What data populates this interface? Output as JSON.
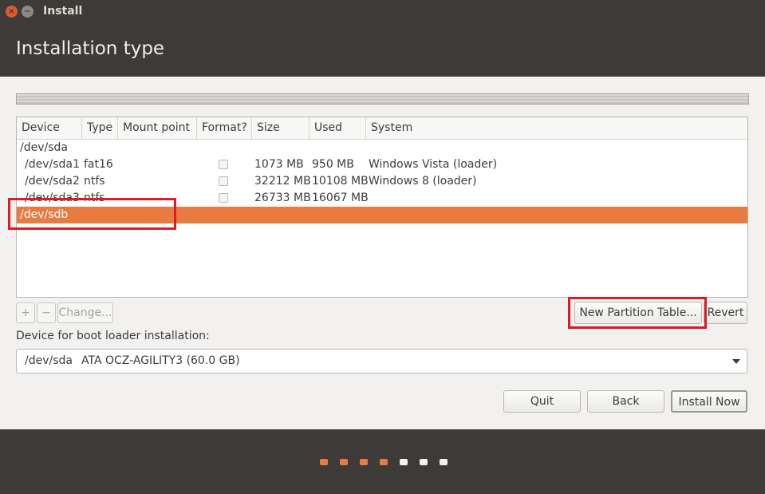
{
  "window": {
    "title": "Install"
  },
  "header": {
    "title": "Installation type"
  },
  "table": {
    "columns": [
      "Device",
      "Type",
      "Mount point",
      "Format?",
      "Size",
      "Used",
      "System"
    ],
    "rows": [
      {
        "device": "/dev/sda",
        "type": "",
        "mount": "",
        "format": false,
        "size": "",
        "used": "",
        "system": ""
      },
      {
        "device": "/dev/sda1",
        "type": "fat16",
        "mount": "",
        "format": false,
        "size": "1073 MB",
        "used": "950 MB",
        "system": "Windows Vista (loader)"
      },
      {
        "device": "/dev/sda2",
        "type": "ntfs",
        "mount": "",
        "format": false,
        "size": "32212 MB",
        "used": "10108 MB",
        "system": "Windows 8 (loader)"
      },
      {
        "device": "/dev/sda3",
        "type": "ntfs",
        "mount": "",
        "format": false,
        "size": "26733 MB",
        "used": "16067 MB",
        "system": ""
      },
      {
        "device": "/dev/sdb",
        "type": "",
        "mount": "",
        "format": false,
        "size": "",
        "used": "",
        "system": "",
        "selected": true
      }
    ]
  },
  "toolbar": {
    "add_label": "+",
    "remove_label": "−",
    "change_label": "Change...",
    "new_table_label": "New Partition Table...",
    "revert_label": "Revert"
  },
  "boot": {
    "label": "Device for boot loader installation:",
    "device": "/dev/sda",
    "model": "ATA OCZ-AGILITY3 (60.0 GB)"
  },
  "buttons": {
    "quit": "Quit",
    "back": "Back",
    "install": "Install Now"
  },
  "progress": {
    "total_steps": 7,
    "completed_steps": 4
  },
  "colors": {
    "accent": "#e87b3f",
    "highlight": "#e01a23",
    "dark": "#3c3b37"
  }
}
